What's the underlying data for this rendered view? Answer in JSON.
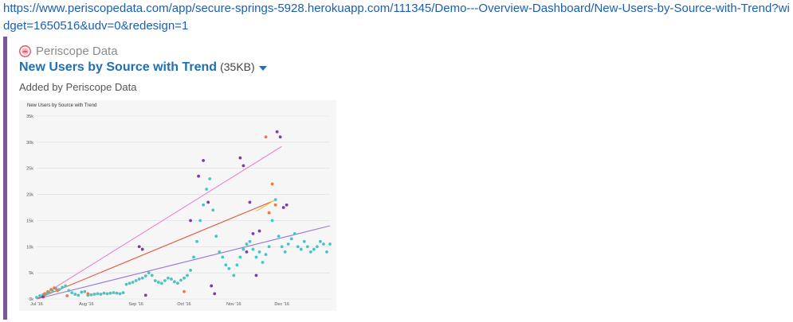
{
  "url": {
    "text": "https://www.periscopedata.com/app/secure-springs-5928.herokuapp.com/111345/Demo---Overview-Dashboard/New-Users-by-Source-with-Trend?widget=1650516&udv=0&redesign=1"
  },
  "card": {
    "site_name": "Periscope Data",
    "title": "New Users by Source with Trend",
    "size": "(35KB)",
    "added_by": "Added by Periscope Data"
  },
  "icons": {
    "logo": "periscope-logo-icon",
    "caret": "caret-down-icon"
  },
  "colors": {
    "accent": "#7a5698",
    "link": "#1f6fb5",
    "teal": "#4cc3c3",
    "purple": "#7b3fa0",
    "orange": "#f07a46",
    "pink": "#e884d2",
    "lavender": "#9a7dd6",
    "red": "#e05a3f",
    "yellow": "#f2c23c"
  },
  "chart_data": {
    "type": "scatter",
    "title": "New Users by Source with Trend",
    "xlabel": "",
    "ylabel": "",
    "x_ticks": [
      "Jul '16",
      "Aug '16",
      "Sep '16",
      "Oct '16",
      "Nov '16",
      "Dec '16"
    ],
    "y_ticks": [
      "0k",
      "5k",
      "10k",
      "15k",
      "20k",
      "25k",
      "30k",
      "35k"
    ],
    "ylim": [
      0,
      35000
    ],
    "grid": true,
    "series": [
      {
        "color": "#4cc3c3",
        "points": [
          [
            "2016-07-01",
            300
          ],
          [
            "2016-07-03",
            600
          ],
          [
            "2016-07-05",
            800
          ],
          [
            "2016-07-07",
            1000
          ],
          [
            "2016-07-09",
            1200
          ],
          [
            "2016-07-11",
            1500
          ],
          [
            "2016-07-13",
            2000
          ],
          [
            "2016-07-15",
            1800
          ],
          [
            "2016-07-17",
            2200
          ],
          [
            "2016-07-19",
            2500
          ],
          [
            "2016-07-21",
            1600
          ],
          [
            "2016-07-23",
            1200
          ],
          [
            "2016-07-25",
            900
          ],
          [
            "2016-07-27",
            700
          ],
          [
            "2016-07-29",
            1300
          ],
          [
            "2016-07-31",
            1400
          ],
          [
            "2016-08-02",
            700
          ],
          [
            "2016-08-04",
            800
          ],
          [
            "2016-08-06",
            900
          ],
          [
            "2016-08-08",
            1000
          ],
          [
            "2016-08-10",
            900
          ],
          [
            "2016-08-12",
            1100
          ],
          [
            "2016-08-14",
            1000
          ],
          [
            "2016-08-16",
            1100
          ],
          [
            "2016-08-18",
            1200
          ],
          [
            "2016-08-20",
            1100
          ],
          [
            "2016-08-22",
            1000
          ],
          [
            "2016-08-24",
            1200
          ],
          [
            "2016-08-26",
            2800
          ],
          [
            "2016-08-28",
            3000
          ],
          [
            "2016-08-30",
            3200
          ],
          [
            "2016-09-01",
            3500
          ],
          [
            "2016-09-03",
            3800
          ],
          [
            "2016-09-05",
            4000
          ],
          [
            "2016-09-07",
            4400
          ],
          [
            "2016-09-09",
            5000
          ],
          [
            "2016-09-11",
            4500
          ],
          [
            "2016-09-13",
            3500
          ],
          [
            "2016-09-15",
            3200
          ],
          [
            "2016-09-17",
            3000
          ],
          [
            "2016-09-19",
            3500
          ],
          [
            "2016-09-21",
            4000
          ],
          [
            "2016-09-23",
            3800
          ],
          [
            "2016-09-25",
            3300
          ],
          [
            "2016-09-27",
            3000
          ],
          [
            "2016-09-29",
            3600
          ],
          [
            "2016-10-01",
            4000
          ],
          [
            "2016-10-03",
            4500
          ],
          [
            "2016-10-05",
            5500
          ],
          [
            "2016-10-07",
            8000
          ],
          [
            "2016-10-09",
            11000
          ],
          [
            "2016-10-11",
            15000
          ],
          [
            "2016-10-13",
            18000
          ],
          [
            "2016-10-15",
            21000
          ],
          [
            "2016-10-17",
            23000
          ],
          [
            "2016-10-19",
            17000
          ],
          [
            "2016-10-21",
            12000
          ],
          [
            "2016-10-23",
            9000
          ],
          [
            "2016-10-25",
            8000
          ],
          [
            "2016-10-27",
            6500
          ],
          [
            "2016-10-29",
            5800
          ],
          [
            "2016-11-01",
            4500
          ],
          [
            "2016-11-03",
            6500
          ],
          [
            "2016-11-05",
            8000
          ],
          [
            "2016-11-07",
            9500
          ],
          [
            "2016-11-09",
            10500
          ],
          [
            "2016-11-11",
            11000
          ],
          [
            "2016-11-13",
            9500
          ],
          [
            "2016-11-15",
            8000
          ],
          [
            "2016-11-17",
            9000
          ],
          [
            "2016-11-19",
            7000
          ],
          [
            "2016-11-21",
            8500
          ],
          [
            "2016-11-23",
            10000
          ],
          [
            "2016-11-25",
            15000
          ],
          [
            "2016-11-27",
            19000
          ],
          [
            "2016-11-29",
            12000
          ],
          [
            "2016-12-01",
            10000
          ],
          [
            "2016-12-03",
            9000
          ],
          [
            "2016-12-05",
            10500
          ],
          [
            "2016-12-07",
            11500
          ],
          [
            "2016-12-09",
            12500
          ],
          [
            "2016-12-11",
            10000
          ],
          [
            "2016-12-13",
            9500
          ],
          [
            "2016-12-15",
            11000
          ],
          [
            "2016-12-17",
            10000
          ],
          [
            "2016-12-19",
            9000
          ],
          [
            "2016-12-21",
            9500
          ],
          [
            "2016-12-23",
            10000
          ],
          [
            "2016-12-25",
            11000
          ],
          [
            "2016-12-27",
            10500
          ],
          [
            "2016-12-29",
            9000
          ],
          [
            "2016-12-31",
            10500
          ]
        ]
      },
      {
        "color": "#7b3fa0",
        "points": [
          [
            "2016-07-05",
            400
          ],
          [
            "2016-09-03",
            10000
          ],
          [
            "2016-09-05",
            9500
          ],
          [
            "2016-09-07",
            700
          ],
          [
            "2016-10-05",
            15000
          ],
          [
            "2016-10-10",
            23500
          ],
          [
            "2016-10-13",
            26500
          ],
          [
            "2016-10-16",
            18500
          ],
          [
            "2016-10-18",
            2500
          ],
          [
            "2016-10-20",
            1000
          ],
          [
            "2016-11-05",
            27000
          ],
          [
            "2016-11-07",
            25500
          ],
          [
            "2016-11-09",
            9000
          ],
          [
            "2016-11-11",
            18500
          ],
          [
            "2016-11-13",
            12500
          ],
          [
            "2016-11-15",
            4500
          ],
          [
            "2016-11-17",
            13000
          ],
          [
            "2016-11-28",
            32000
          ],
          [
            "2016-11-30",
            31000
          ],
          [
            "2016-12-02",
            17500
          ],
          [
            "2016-12-04",
            18000
          ]
        ]
      },
      {
        "color": "#f07a46",
        "points": [
          [
            "2016-07-06",
            1000
          ],
          [
            "2016-07-08",
            1400
          ],
          [
            "2016-07-10",
            1800
          ],
          [
            "2016-07-12",
            2100
          ],
          [
            "2016-07-14",
            1600
          ],
          [
            "2016-07-20",
            600
          ],
          [
            "2016-08-02",
            1000
          ],
          [
            "2016-10-01",
            1400
          ],
          [
            "2016-11-21",
            31000
          ],
          [
            "2016-11-23",
            16500
          ],
          [
            "2016-11-25",
            22000
          ],
          [
            "2016-11-27",
            18000
          ]
        ]
      }
    ],
    "trend_lines": [
      {
        "color": "#e884d2",
        "from": [
          "2016-07-01",
          0
        ],
        "to": [
          "2016-12-01",
          29200
        ]
      },
      {
        "color": "#9a7dd6",
        "from": [
          "2016-07-01",
          0
        ],
        "to": [
          "2016-12-31",
          14000
        ]
      },
      {
        "color": "#e05a3f",
        "from": [
          "2016-07-01",
          0
        ],
        "to": [
          "2016-11-26",
          18800
        ]
      },
      {
        "color": "#f2c23c",
        "from": [
          "2016-11-15",
          16800
        ],
        "to": [
          "2016-11-28",
          19200
        ]
      }
    ]
  }
}
